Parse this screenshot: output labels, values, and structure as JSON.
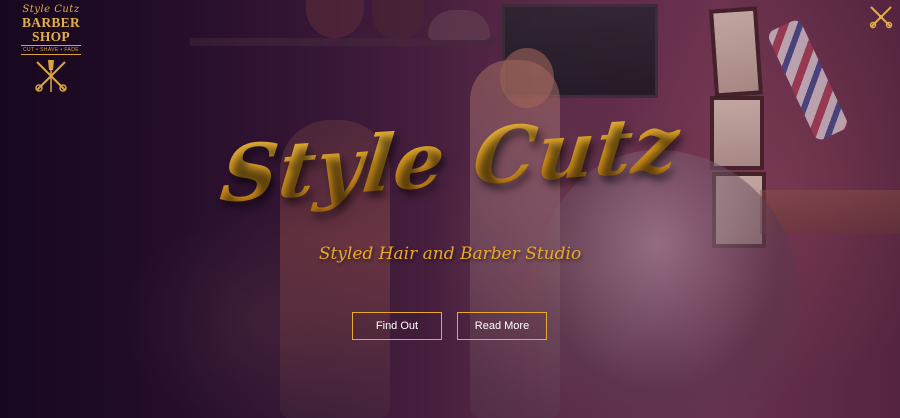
{
  "logo": {
    "script_text": "Style Cutz",
    "main_text": "BARBER SHOP",
    "tagline": "CUT • SHAVE • FADE",
    "icon": "crossed-scissors-razor-icon"
  },
  "corner_icon": "crossed-tools-icon",
  "hero": {
    "title": "Style Cutz",
    "subtitle": "Styled Hair and Barber Studio",
    "buttons": {
      "find_out": "Find Out",
      "read_more": "Read More"
    }
  },
  "colors": {
    "accent_gold": "#d49a1f",
    "overlay_purple": "#3a1838",
    "button_text": "#ffffff"
  }
}
